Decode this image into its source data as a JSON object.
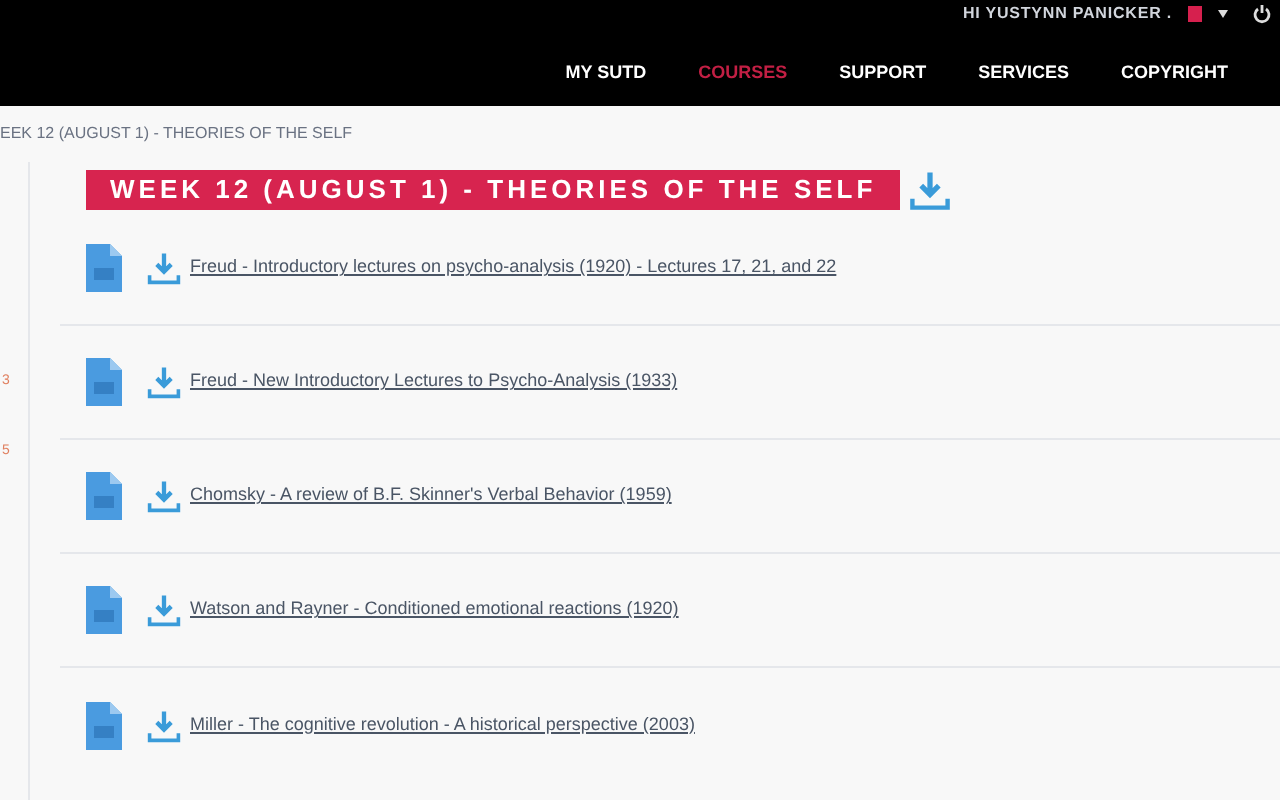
{
  "header": {
    "greeting": "HI YUSTYNN PANICKER .",
    "nav": [
      {
        "label": "MY SUTD",
        "selected": false
      },
      {
        "label": "COURSES",
        "selected": true
      },
      {
        "label": "SUPPORT",
        "selected": false
      },
      {
        "label": "SERVICES",
        "selected": false
      },
      {
        "label": "COPYRIGHT",
        "selected": false
      }
    ]
  },
  "breadcrumb": "EEK 12 (AUGUST 1) - THEORIES OF THE SELF",
  "sidebar": {
    "items": [
      "3",
      "5"
    ]
  },
  "section": {
    "title": "WEEK 12 (AUGUST 1) - THEORIES OF THE SELF",
    "files": [
      "Freud - Introductory lectures on psycho-analysis (1920) - Lectures 17, 21, and 22",
      "Freud - New Introductory Lectures to Psycho-Analysis (1933)",
      "Chomsky - A review of B.F. Skinner's Verbal Behavior (1959)",
      "Watson and Rayner - Conditioned emotional reactions (1920)",
      "Miller - The cognitive revolution - A historical perspective (2003)"
    ]
  }
}
